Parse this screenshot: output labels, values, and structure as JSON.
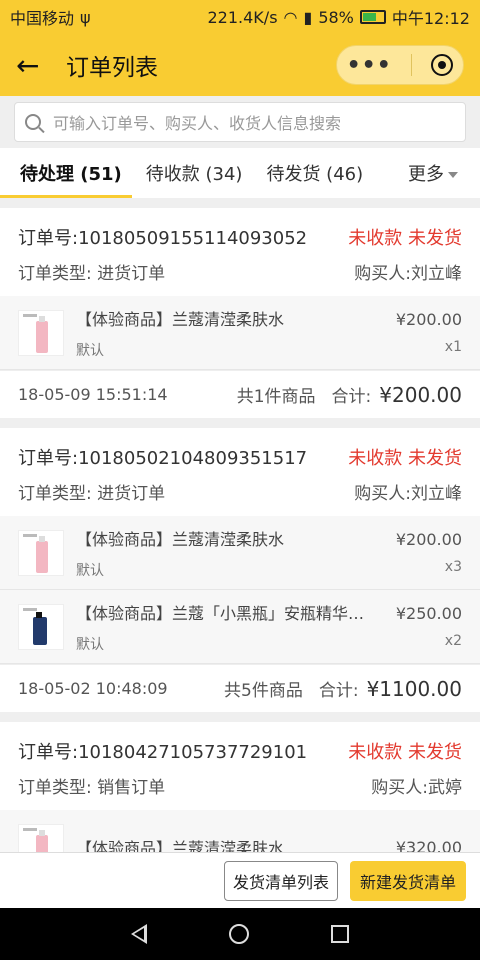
{
  "statusbar": {
    "carrier": "中国移动",
    "speed": "221.4K/s",
    "battery": "58%",
    "time": "中午12:12"
  },
  "navbar": {
    "title": "订单列表",
    "more_label": "•••"
  },
  "search": {
    "placeholder": "可输入订单号、购买人、收货人信息搜索"
  },
  "tabs": {
    "items": [
      {
        "label": "待处理 (51)"
      },
      {
        "label": "待收款 (34)"
      },
      {
        "label": "待发货 (46)"
      }
    ],
    "more": "更多"
  },
  "orders": [
    {
      "order_no": "订单号:10180509155114093052",
      "status": "未收款 未发货",
      "type": "订单类型: 进货订单",
      "buyer": "购买人:刘立峰",
      "items": [
        {
          "name": "【体验商品】兰蔻清滢柔肤水",
          "sku": "默认",
          "price": "¥200.00",
          "qty": "x1"
        }
      ],
      "date": "18-05-09 15:51:14",
      "count": "共1件商品",
      "total_label": "合计:",
      "total": "¥200.00"
    },
    {
      "order_no": "订单号:10180502104809351517",
      "status": "未收款 未发货",
      "type": "订单类型: 进货订单",
      "buyer": "购买人:刘立峰",
      "items": [
        {
          "name": "【体验商品】兰蔻清滢柔肤水",
          "sku": "默认",
          "price": "¥200.00",
          "qty": "x3"
        },
        {
          "name": "【体验商品】兰蔻「小黑瓶」安瓶精华…",
          "sku": "默认",
          "price": "¥250.00",
          "qty": "x2"
        }
      ],
      "date": "18-05-02 10:48:09",
      "count": "共5件商品",
      "total_label": "合计:",
      "total": "¥1100.00"
    },
    {
      "order_no": "订单号:10180427105737729101",
      "status": "未收款 未发货",
      "type": "订单类型: 销售订单",
      "buyer": "购买人:武婷",
      "items": [
        {
          "name": "【体验商品】兰蔻清滢柔肤水",
          "sku": "",
          "price": "¥320.00",
          "qty": ""
        }
      ]
    }
  ],
  "bottombar": {
    "list_button": "发货清单列表",
    "new_button": "新建发货清单"
  }
}
